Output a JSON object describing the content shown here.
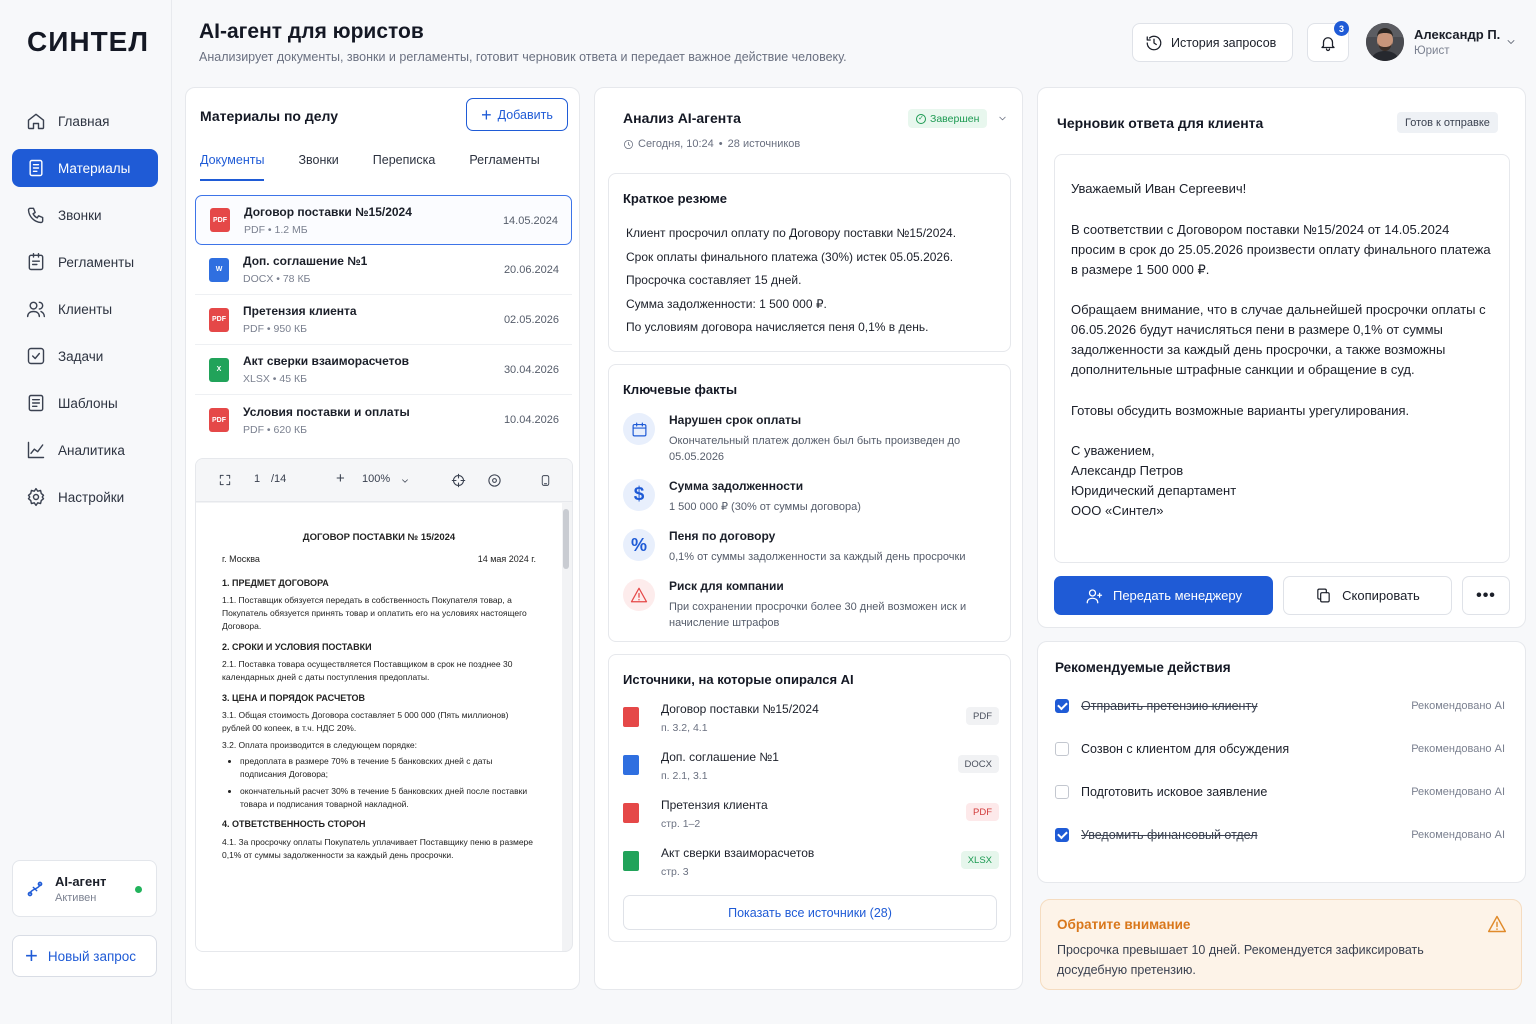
{
  "app": {
    "logo": "СИНТЕЛ"
  },
  "sidebar": {
    "items": [
      {
        "label": "Главная",
        "icon": "home-icon"
      },
      {
        "label": "Материалы",
        "icon": "documents-icon",
        "active": true
      },
      {
        "label": "Звонки",
        "icon": "phone-icon"
      },
      {
        "label": "Регламенты",
        "icon": "regulations-icon"
      },
      {
        "label": "Клиенты",
        "icon": "users-icon"
      },
      {
        "label": "Задачи",
        "icon": "tasks-icon"
      },
      {
        "label": "Шаблоны",
        "icon": "templates-icon"
      },
      {
        "label": "Аналитика",
        "icon": "analytics-icon"
      },
      {
        "label": "Настройки",
        "icon": "settings-icon"
      }
    ],
    "agent": {
      "title": "AI-агент",
      "status": "Активен"
    },
    "new_request": "Новый запрос"
  },
  "header": {
    "title": "AI-агент для юристов",
    "subtitle": "Анализирует документы, звонки и регламенты, готовит черновик ответа и передает важное действие человеку.",
    "history_button": "История запросов",
    "notifications_count": "3",
    "user": {
      "name": "Александр П.",
      "role": "Юрист"
    }
  },
  "materials": {
    "title": "Материалы по делу",
    "add_button": "Добавить",
    "tabs": [
      "Документы",
      "Звонки",
      "Переписка",
      "Регламенты"
    ],
    "documents": [
      {
        "name": "Договор поставки №15/2024",
        "meta": "PDF • 1.2 МБ",
        "date": "14.05.2024",
        "type": "PDF"
      },
      {
        "name": "Доп. соглашение №1",
        "meta": "DOCX • 78 КБ",
        "date": "20.06.2024",
        "type": "W"
      },
      {
        "name": "Претензия клиента",
        "meta": "PDF • 950 КБ",
        "date": "02.05.2026",
        "type": "PDF"
      },
      {
        "name": "Акт сверки взаиморасчетов",
        "meta": "XLSX • 45 КБ",
        "date": "30.04.2026",
        "type": "X"
      },
      {
        "name": "Условия поставки и оплаты",
        "meta": "PDF • 620 КБ",
        "date": "10.04.2026",
        "type": "PDF"
      }
    ],
    "viewer": {
      "page": "1",
      "total": "/14",
      "zoom": "100%",
      "doc_title": "ДОГОВОР ПОСТАВКИ № 15/2024",
      "city": "г. Москва",
      "date": "14 мая 2024 г.",
      "s1": "1.   ПРЕДМЕТ ДОГОВОРА",
      "p11": "1.1. Поставщик обязуется передать в собственность Покупателя товар, а Покупатель обязуется принять товар и оплатить его на условиях настоящего Договора.",
      "s2": "2.   СРОКИ И УСЛОВИЯ ПОСТАВКИ",
      "p21": "2.1. Поставка товара осуществляется Поставщиком в срок не позднее 30 календарных дней с даты поступления предоплаты.",
      "s3": "3. ЦЕНА И ПОРЯДОК РАСЧЕТОВ",
      "p31": "3.1. Общая стоимость Договора составляет 5 000 000 (Пять миллионов) рублей 00 копеек, в т.ч. НДС 20%.",
      "p32": "3.2. Оплата производится в следующем порядке:",
      "b1": "предоплата в размере 70% в течение 5 банковских дней с даты подписания Договора;",
      "b2": "окончательный расчет 30% в течение 5 банковских дней после поставки товара и подписания товарной накладной.",
      "s4": "4.   ОТВЕТСТВЕННОСТЬ СТОРОН",
      "p41": "4.1. За просрочку оплаты Покупатель уплачивает Поставщику пеню в размере 0,1% от суммы задолженности за каждый день просрочки."
    }
  },
  "analysis": {
    "title": "Анализ AI-агента",
    "status": "Завершен",
    "time": "Сегодня, 10:24",
    "sources_count": "28 источников",
    "summary": {
      "title": "Краткое резюме",
      "lines": [
        "Клиент просрочил оплату по Договору поставки №15/2024.",
        "Срок оплаты финального платежа (30%) истек 05.05.2026.",
        "Просрочка составляет 15 дней.",
        "Сумма задолженности: 1 500 000 ₽.",
        "По условиям договора начисляется пеня 0,1% в день."
      ]
    },
    "facts": {
      "title": "Ключевые факты",
      "items": [
        {
          "title": "Нарушен срок оплаты",
          "desc": "Окончательный платеж должен был быть произведен до 05.05.2026",
          "icon": "calendar-icon"
        },
        {
          "title": "Сумма задолженности",
          "desc": "1 500 000 ₽ (30% от суммы договора)",
          "icon": "dollar-icon"
        },
        {
          "title": "Пеня по договору",
          "desc": "0,1% от суммы задолженности за каждый день просрочки",
          "icon": "percent-icon"
        },
        {
          "title": "Риск для компании",
          "desc": "При сохранении просрочки более 30 дней возможен иск и начисление штрафов",
          "icon": "warning-icon"
        }
      ]
    },
    "sources": {
      "title": "Источники, на которые опирался AI",
      "items": [
        {
          "name": "Договор поставки №15/2024",
          "pages": "п. 3.2, 4.1",
          "tag": "PDF"
        },
        {
          "name": "Доп. соглашение №1",
          "pages": "п. 2.1, 3.1",
          "tag": "DOCX"
        },
        {
          "name": "Претензия клиента",
          "pages": "стр. 1–2",
          "tag": "PDF"
        },
        {
          "name": "Акт сверки взаиморасчетов",
          "pages": "стр. 3",
          "tag": "XLSX"
        }
      ],
      "show_all": "Показать все источники (28)"
    }
  },
  "draft": {
    "title": "Черновик ответа для клиента",
    "status": "Готов к отправке",
    "greeting": "Уважаемый Иван Сергеевич!",
    "p1": "В соответствии с Договором поставки №15/2024 от 14.05.2024 просим в срок до 25.05.2026 произвести оплату финального платежа в размере 1 500 000 ₽.",
    "p2": "Обращаем внимание, что в случае дальнейшей просрочки оплаты с 06.05.2026 будут начисляться пени в размере 0,1% от суммы задолженности за каждый день просрочки, а также возможны дополнительные штрафные санкции и обращение в суд.",
    "p3": "Готовы обсудить возможные варианты урегулирования.",
    "sign1": "С уважением,",
    "sign2": "Александр Петров",
    "sign3": "Юридический департамент",
    "sign4": "ООО «Синтел»",
    "send_button": "Передать менеджеру",
    "copy_button": "Скопировать",
    "more_button": "•••"
  },
  "recommendations": {
    "title": "Рекомендуемые действия",
    "items": [
      {
        "label": "Отправить претензию клиенту",
        "checked": true,
        "tag": "Рекомендовано AI"
      },
      {
        "label": "Созвон с клиентом для обсуждения",
        "checked": false,
        "tag": "Рекомендовано AI"
      },
      {
        "label": "Подготовить исковое заявление",
        "checked": false,
        "tag": "Рекомендовано AI"
      },
      {
        "label": "Уведомить финансовый отдел",
        "checked": true,
        "tag": "Рекомендовано AI"
      }
    ]
  },
  "warning": {
    "title": "Обратите внимание",
    "text": "Просрочка превышает 10 дней. Рекомендуется зафиксировать досудебную претензию."
  },
  "colors": {
    "accent": "#1f5bd6",
    "success": "#1c9a52",
    "warning": "#d9771b",
    "danger": "#e54848"
  }
}
